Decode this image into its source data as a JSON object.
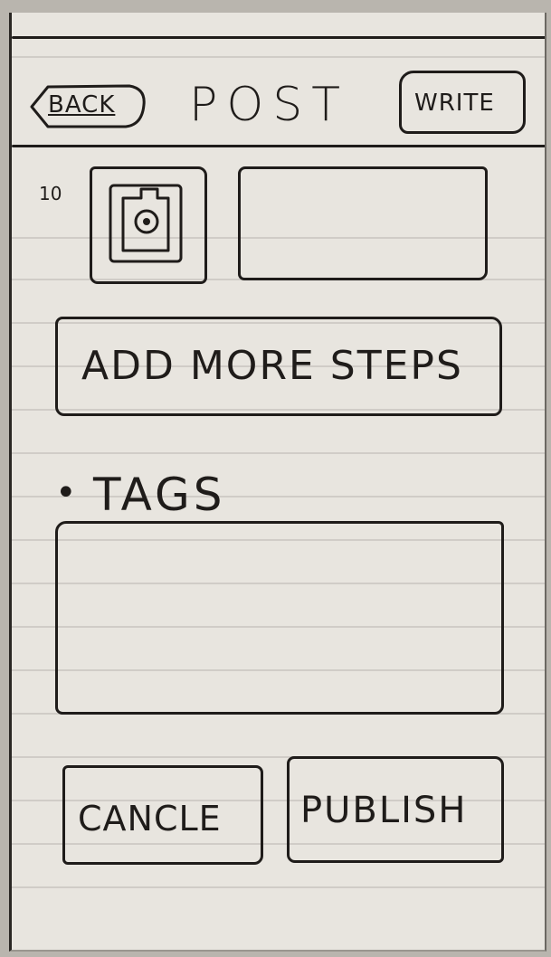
{
  "header": {
    "back_label": "BACK",
    "title": "POST",
    "write_label": "WRITE"
  },
  "step": {
    "number": "10"
  },
  "add_steps": {
    "label": "ADD MORE STEPS"
  },
  "tags": {
    "bullet": "•",
    "label": "TAGS"
  },
  "footer": {
    "cancel_label": "CANCLE",
    "publish_label": "PUBLISH"
  },
  "colors": {
    "ink": "#1f1c1a",
    "paper": "#e8e5df",
    "rule": "#c9c6c1"
  }
}
